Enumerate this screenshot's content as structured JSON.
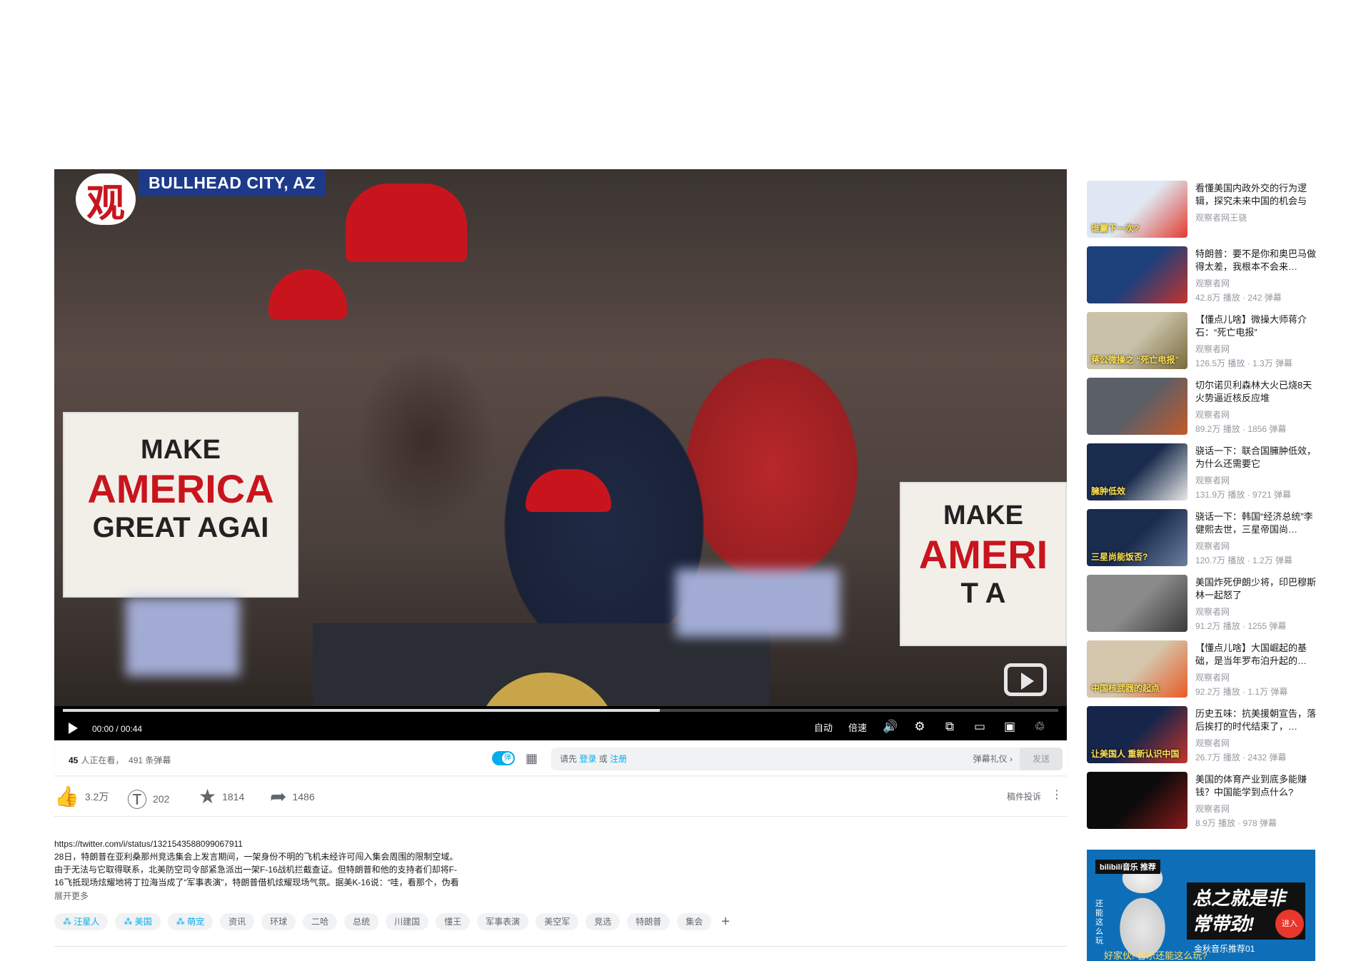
{
  "player": {
    "location_banner": "BULLHEAD CITY, AZ",
    "logo_char": "观",
    "sign_left": [
      "MAKE",
      "AMERICA",
      "GREAT AGAI"
    ],
    "sign_right": [
      "MAKE",
      "AMERI",
      "T A"
    ],
    "time_current": "00:00",
    "time_total": "00:44",
    "progress": 0.6,
    "auto_label": "自动",
    "speed_label": "倍速"
  },
  "danmaku_bar": {
    "viewers_count": "45",
    "viewers_label": "人正在看，",
    "danmaku_count": "491 条弹幕",
    "input_prefix": "请先",
    "login": "登录",
    "or": "或",
    "register": "注册",
    "etiquette": "弹幕礼仪 ›",
    "send": "发送"
  },
  "actions": {
    "like": "3.2万",
    "coin": "202",
    "favorite": "1814",
    "share": "1486",
    "report": "稿件投诉"
  },
  "description": {
    "url": "https://twitter.com/i/status/1321543588099067911",
    "text": "28日，特朗普在亚利桑那州竞选集会上发言期间，一架身份不明的飞机未经许可闯入集会周围的限制空域。由于无法与它取得联系，北美防空司令部紧急派出一架F-16战机拦截查证。但特朗普和他的支持者们却将F-16飞抵现场炫耀地将丁拉海当成了“军事表演”，特朗普借机炫耀现场气氛。据美K-16说：“哇，看那个，伪看",
    "expand": "展开更多"
  },
  "tags": [
    {
      "label": "汪星人",
      "topic": true
    },
    {
      "label": "美国",
      "topic": true
    },
    {
      "label": "萌宠",
      "topic": true
    },
    {
      "label": "资讯",
      "topic": false
    },
    {
      "label": "环球",
      "topic": false
    },
    {
      "label": "二哈",
      "topic": false
    },
    {
      "label": "总统",
      "topic": false
    },
    {
      "label": "川建国",
      "topic": false
    },
    {
      "label": "懂王",
      "topic": false
    },
    {
      "label": "军事表演",
      "topic": false
    },
    {
      "label": "美空军",
      "topic": false
    },
    {
      "label": "竞选",
      "topic": false
    },
    {
      "label": "特朗普",
      "topic": false
    },
    {
      "label": "集会",
      "topic": false
    }
  ],
  "recommendations": [
    {
      "title": "看懂美国内政外交的行为逻辑，探究未来中国的机会与",
      "author": "观察者网王骁",
      "stats": "",
      "colors": [
        "#dfe8f2",
        "#e23b2e"
      ],
      "overlay": "谁赢下一次?"
    },
    {
      "title": "特朗普：要不是你和奥巴马做得太差，我根本不会来…",
      "author": "观察者网",
      "stats": "42.8万 播放 · 242 弹幕",
      "colors": [
        "#1d3f7a",
        "#c3342c"
      ],
      "overlay": ""
    },
    {
      "title": "【懂点儿啥】微操大师蒋介石：“死亡电报”",
      "author": "观察者网",
      "stats": "126.5万 播放 · 1.3万 弹幕",
      "colors": [
        "#c9c2a8",
        "#7a6a3c"
      ],
      "overlay": "蒋公微操之 “死亡电报”"
    },
    {
      "title": "切尔诺贝利森林大火已烧8天 火势逼近核反应堆",
      "author": "观察者网",
      "stats": "89.2万 播放 · 1856 弹幕",
      "colors": [
        "#5b5f68",
        "#c25a2a"
      ],
      "overlay": ""
    },
    {
      "title": "骁话一下：联合国臃肿低效，为什么还需要它",
      "author": "观察者网",
      "stats": "131.9万 播放 · 9721 弹幕",
      "colors": [
        "#1a2c4d",
        "#e8e8e8"
      ],
      "overlay": "臃肿低效"
    },
    {
      "title": "骁话一下：韩国“经济总统”李健熙去世，三星帝国尚…",
      "author": "观察者网",
      "stats": "120.7万 播放 · 1.2万 弹幕",
      "colors": [
        "#1a2c4d",
        "#6b7fa0"
      ],
      "overlay": "三星尚能饭否?"
    },
    {
      "title": "美国炸死伊朗少将，印巴穆斯林一起怒了",
      "author": "观察者网",
      "stats": "91.2万 播放 · 1255 弹幕",
      "colors": [
        "#8a8a8a",
        "#3a3a3a"
      ],
      "overlay": ""
    },
    {
      "title": "【懂点儿啥】大国崛起的基础，是当年罗布泊升起的…",
      "author": "观察者网",
      "stats": "92.2万 播放 · 1.1万 弹幕",
      "colors": [
        "#d5c7ad",
        "#e85a23"
      ],
      "overlay": "中国核武器的起点"
    },
    {
      "title": "历史五味：抗美援朝宣告，落后挨打的时代结束了，…",
      "author": "观察者网",
      "stats": "26.7万 播放 · 2432 弹幕",
      "colors": [
        "#16254a",
        "#c3342c"
      ],
      "overlay": "让美国人 重新认识中国"
    },
    {
      "title": "美国的体育产业到底多能赚钱？中国能学到点什么?",
      "author": "观察者网",
      "stats": "8.9万 播放 · 978 弹幕",
      "colors": [
        "#0b0b0b",
        "#8a1a1a"
      ],
      "overlay": ""
    }
  ],
  "banner": {
    "tagline": "bilibili音乐 推荐",
    "headline": "总之就是非常带劲!",
    "subline": "金秋音乐推荐01",
    "bottom_text": "好家伙! 音乐还能这么玩?",
    "side_text": "还能这么玩",
    "enter": "进入"
  }
}
